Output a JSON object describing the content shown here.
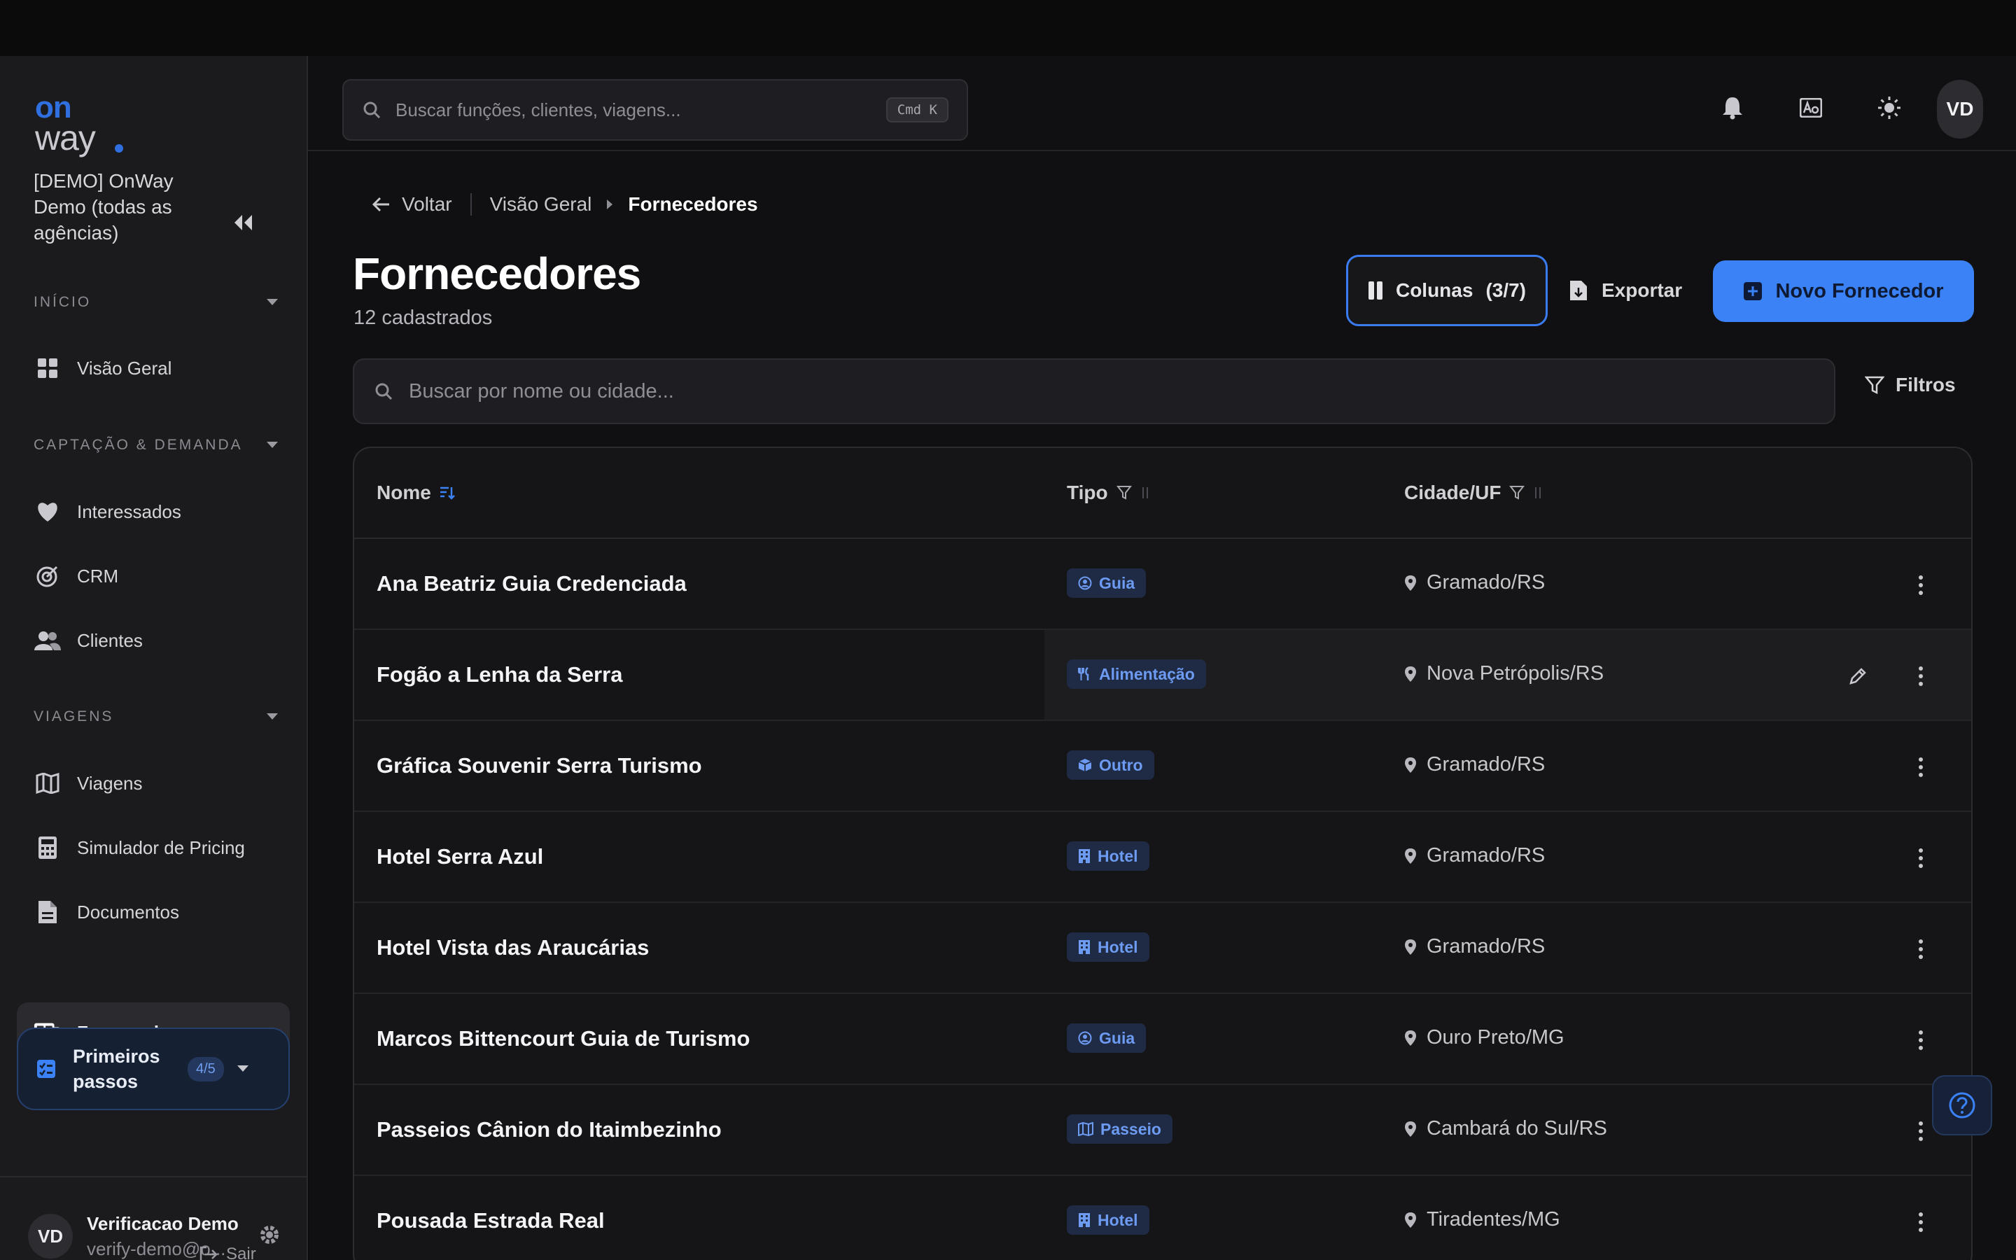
{
  "brand": {
    "logo_top": "on",
    "logo_bottom": "way",
    "accent": "#3b82f6"
  },
  "org": {
    "name": "[DEMO] OnWay Demo (todas as agências)"
  },
  "sidebar": {
    "sections": [
      {
        "title": "INÍCIO"
      },
      {
        "title": "CAPTAÇÃO & DEMANDA"
      },
      {
        "title": "VIAGENS"
      }
    ],
    "items": [
      {
        "label": "Visão Geral",
        "icon": "grid-icon"
      },
      {
        "label": "Interessados",
        "icon": "heart-icon"
      },
      {
        "label": "CRM",
        "icon": "target-icon"
      },
      {
        "label": "Clientes",
        "icon": "users-icon"
      },
      {
        "label": "Viagens",
        "icon": "map-icon"
      },
      {
        "label": "Simulador de Pricing",
        "icon": "calculator-icon"
      },
      {
        "label": "Documentos",
        "icon": "document-icon"
      },
      {
        "label": "Fornecedores",
        "icon": "bus-icon",
        "active": true
      }
    ],
    "first_steps": {
      "label": "Primeiros passos",
      "progress": "4/5"
    },
    "user": {
      "initials": "VD",
      "name": "Verificacao Demo",
      "email": "verify-demo@o..."
    },
    "logout_label": "Sair"
  },
  "header": {
    "search_placeholder": "Buscar funções, clientes, viagens...",
    "shortcut": "Cmd K",
    "avatar_initials": "VD"
  },
  "breadcrumb": {
    "back": "Voltar",
    "parent": "Visão Geral",
    "current": "Fornecedores"
  },
  "page": {
    "title": "Fornecedores",
    "subtitle": "12 cadastrados",
    "columns_button": "Colunas",
    "columns_count": "(3/7)",
    "export_button": "Exportar",
    "new_button": "Novo Fornecedor",
    "search_placeholder": "Buscar por nome ou cidade...",
    "filters_button": "Filtros"
  },
  "table": {
    "headers": {
      "name": "Nome",
      "type": "Tipo",
      "city": "Cidade/UF"
    },
    "rows": [
      {
        "name": "Ana Beatriz Guia Credenciada",
        "type": "Guia",
        "type_icon": "person-badge-icon",
        "city": "Gramado/RS"
      },
      {
        "name": "Fogão a Lenha da Serra",
        "type": "Alimentação",
        "type_icon": "utensils-icon",
        "city": "Nova Petrópolis/RS"
      },
      {
        "name": "Gráfica Souvenir Serra Turismo",
        "type": "Outro",
        "type_icon": "box-icon",
        "city": "Gramado/RS"
      },
      {
        "name": "Hotel Serra Azul",
        "type": "Hotel",
        "type_icon": "building-icon",
        "city": "Gramado/RS"
      },
      {
        "name": "Hotel Vista das Araucárias",
        "type": "Hotel",
        "type_icon": "building-icon",
        "city": "Gramado/RS"
      },
      {
        "name": "Marcos Bittencourt Guia de Turismo",
        "type": "Guia",
        "type_icon": "person-badge-icon",
        "city": "Ouro Preto/MG"
      },
      {
        "name": "Passeios Cânion do Itaimbezinho",
        "type": "Passeio",
        "type_icon": "map-icon",
        "city": "Cambará do Sul/RS"
      },
      {
        "name": "Pousada Estrada Real",
        "type": "Hotel",
        "type_icon": "building-icon",
        "city": "Tiradentes/MG"
      }
    ]
  }
}
